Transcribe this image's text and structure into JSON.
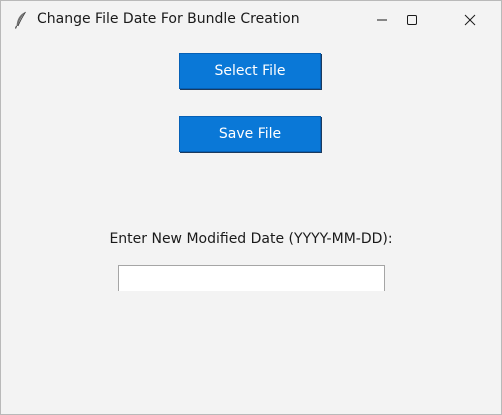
{
  "window": {
    "title": "Change File Date For Bundle Creation",
    "icon": "feather-icon",
    "controls": [
      "minimize-icon",
      "maximize-icon",
      "close-icon"
    ]
  },
  "buttons": {
    "select_file": "Select File",
    "save_file": "Save File"
  },
  "date_field": {
    "label": "Enter New Modified Date (YYYY-MM-DD):",
    "value": ""
  },
  "colors": {
    "button_bg": "#0a78d7",
    "window_bg": "#f3f3f3"
  }
}
